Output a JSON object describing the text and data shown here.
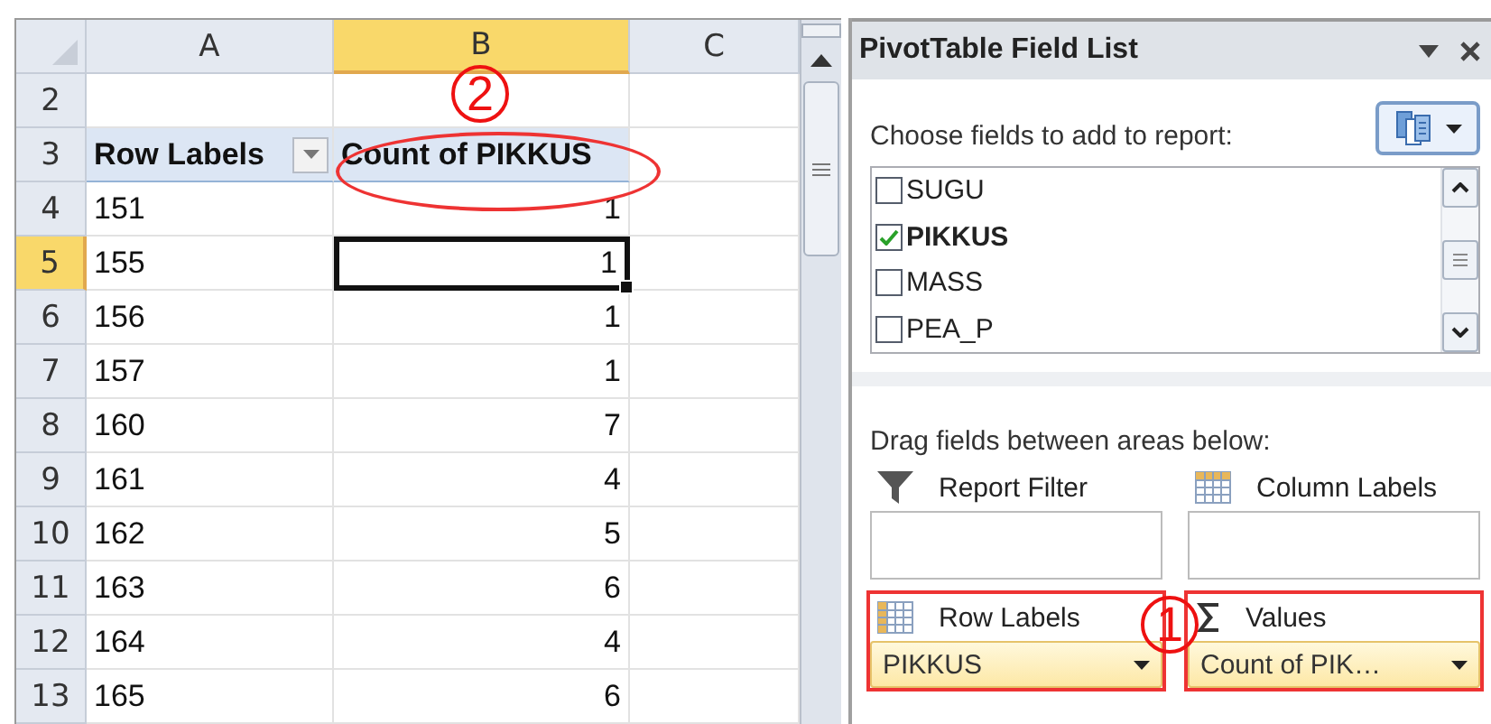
{
  "sheet": {
    "columns": [
      {
        "label": "A",
        "selected": false
      },
      {
        "label": "B",
        "selected": true
      },
      {
        "label": "C",
        "selected": false
      }
    ],
    "rows": [
      {
        "number": "2",
        "kind": "blank",
        "selected": false
      },
      {
        "number": "3",
        "kind": "header",
        "selected": false,
        "label": "Row Labels",
        "count": "Count of PIKKUS"
      },
      {
        "number": "4",
        "kind": "data",
        "selected": false,
        "label": "151",
        "count": "1"
      },
      {
        "number": "5",
        "kind": "data",
        "selected": true,
        "label": "155",
        "count": "1"
      },
      {
        "number": "6",
        "kind": "data",
        "selected": false,
        "label": "156",
        "count": "1"
      },
      {
        "number": "7",
        "kind": "data",
        "selected": false,
        "label": "157",
        "count": "1"
      },
      {
        "number": "8",
        "kind": "data",
        "selected": false,
        "label": "160",
        "count": "7"
      },
      {
        "number": "9",
        "kind": "data",
        "selected": false,
        "label": "161",
        "count": "4"
      },
      {
        "number": "10",
        "kind": "data",
        "selected": false,
        "label": "162",
        "count": "5"
      },
      {
        "number": "11",
        "kind": "data",
        "selected": false,
        "label": "163",
        "count": "6"
      },
      {
        "number": "12",
        "kind": "data",
        "selected": false,
        "label": "164",
        "count": "4"
      },
      {
        "number": "13",
        "kind": "data",
        "selected": false,
        "label": "165",
        "count": "6"
      }
    ]
  },
  "field_list": {
    "title": "PivotTable Field List",
    "prompt": "Choose fields to add to report:",
    "fields": [
      {
        "name": "SUGU",
        "checked": false
      },
      {
        "name": "PIKKUS",
        "checked": true
      },
      {
        "name": "MASS",
        "checked": false
      },
      {
        "name": "PEA_P",
        "checked": false
      }
    ],
    "drag_hint": "Drag fields between areas below:",
    "areas": [
      {
        "kind": "filter",
        "label": "Report Filter",
        "highlighted": false
      },
      {
        "kind": "columns",
        "label": "Column Labels",
        "highlighted": false
      },
      {
        "kind": "rows",
        "label": "Row Labels",
        "chip": "PIKKUS",
        "highlighted": true
      },
      {
        "kind": "values",
        "label": "Values",
        "chip": "Count of PIK…",
        "highlighted": true
      }
    ]
  },
  "annotations": [
    {
      "kind": "sheet",
      "text": "2"
    },
    {
      "kind": "areas",
      "text": "1"
    }
  ]
}
